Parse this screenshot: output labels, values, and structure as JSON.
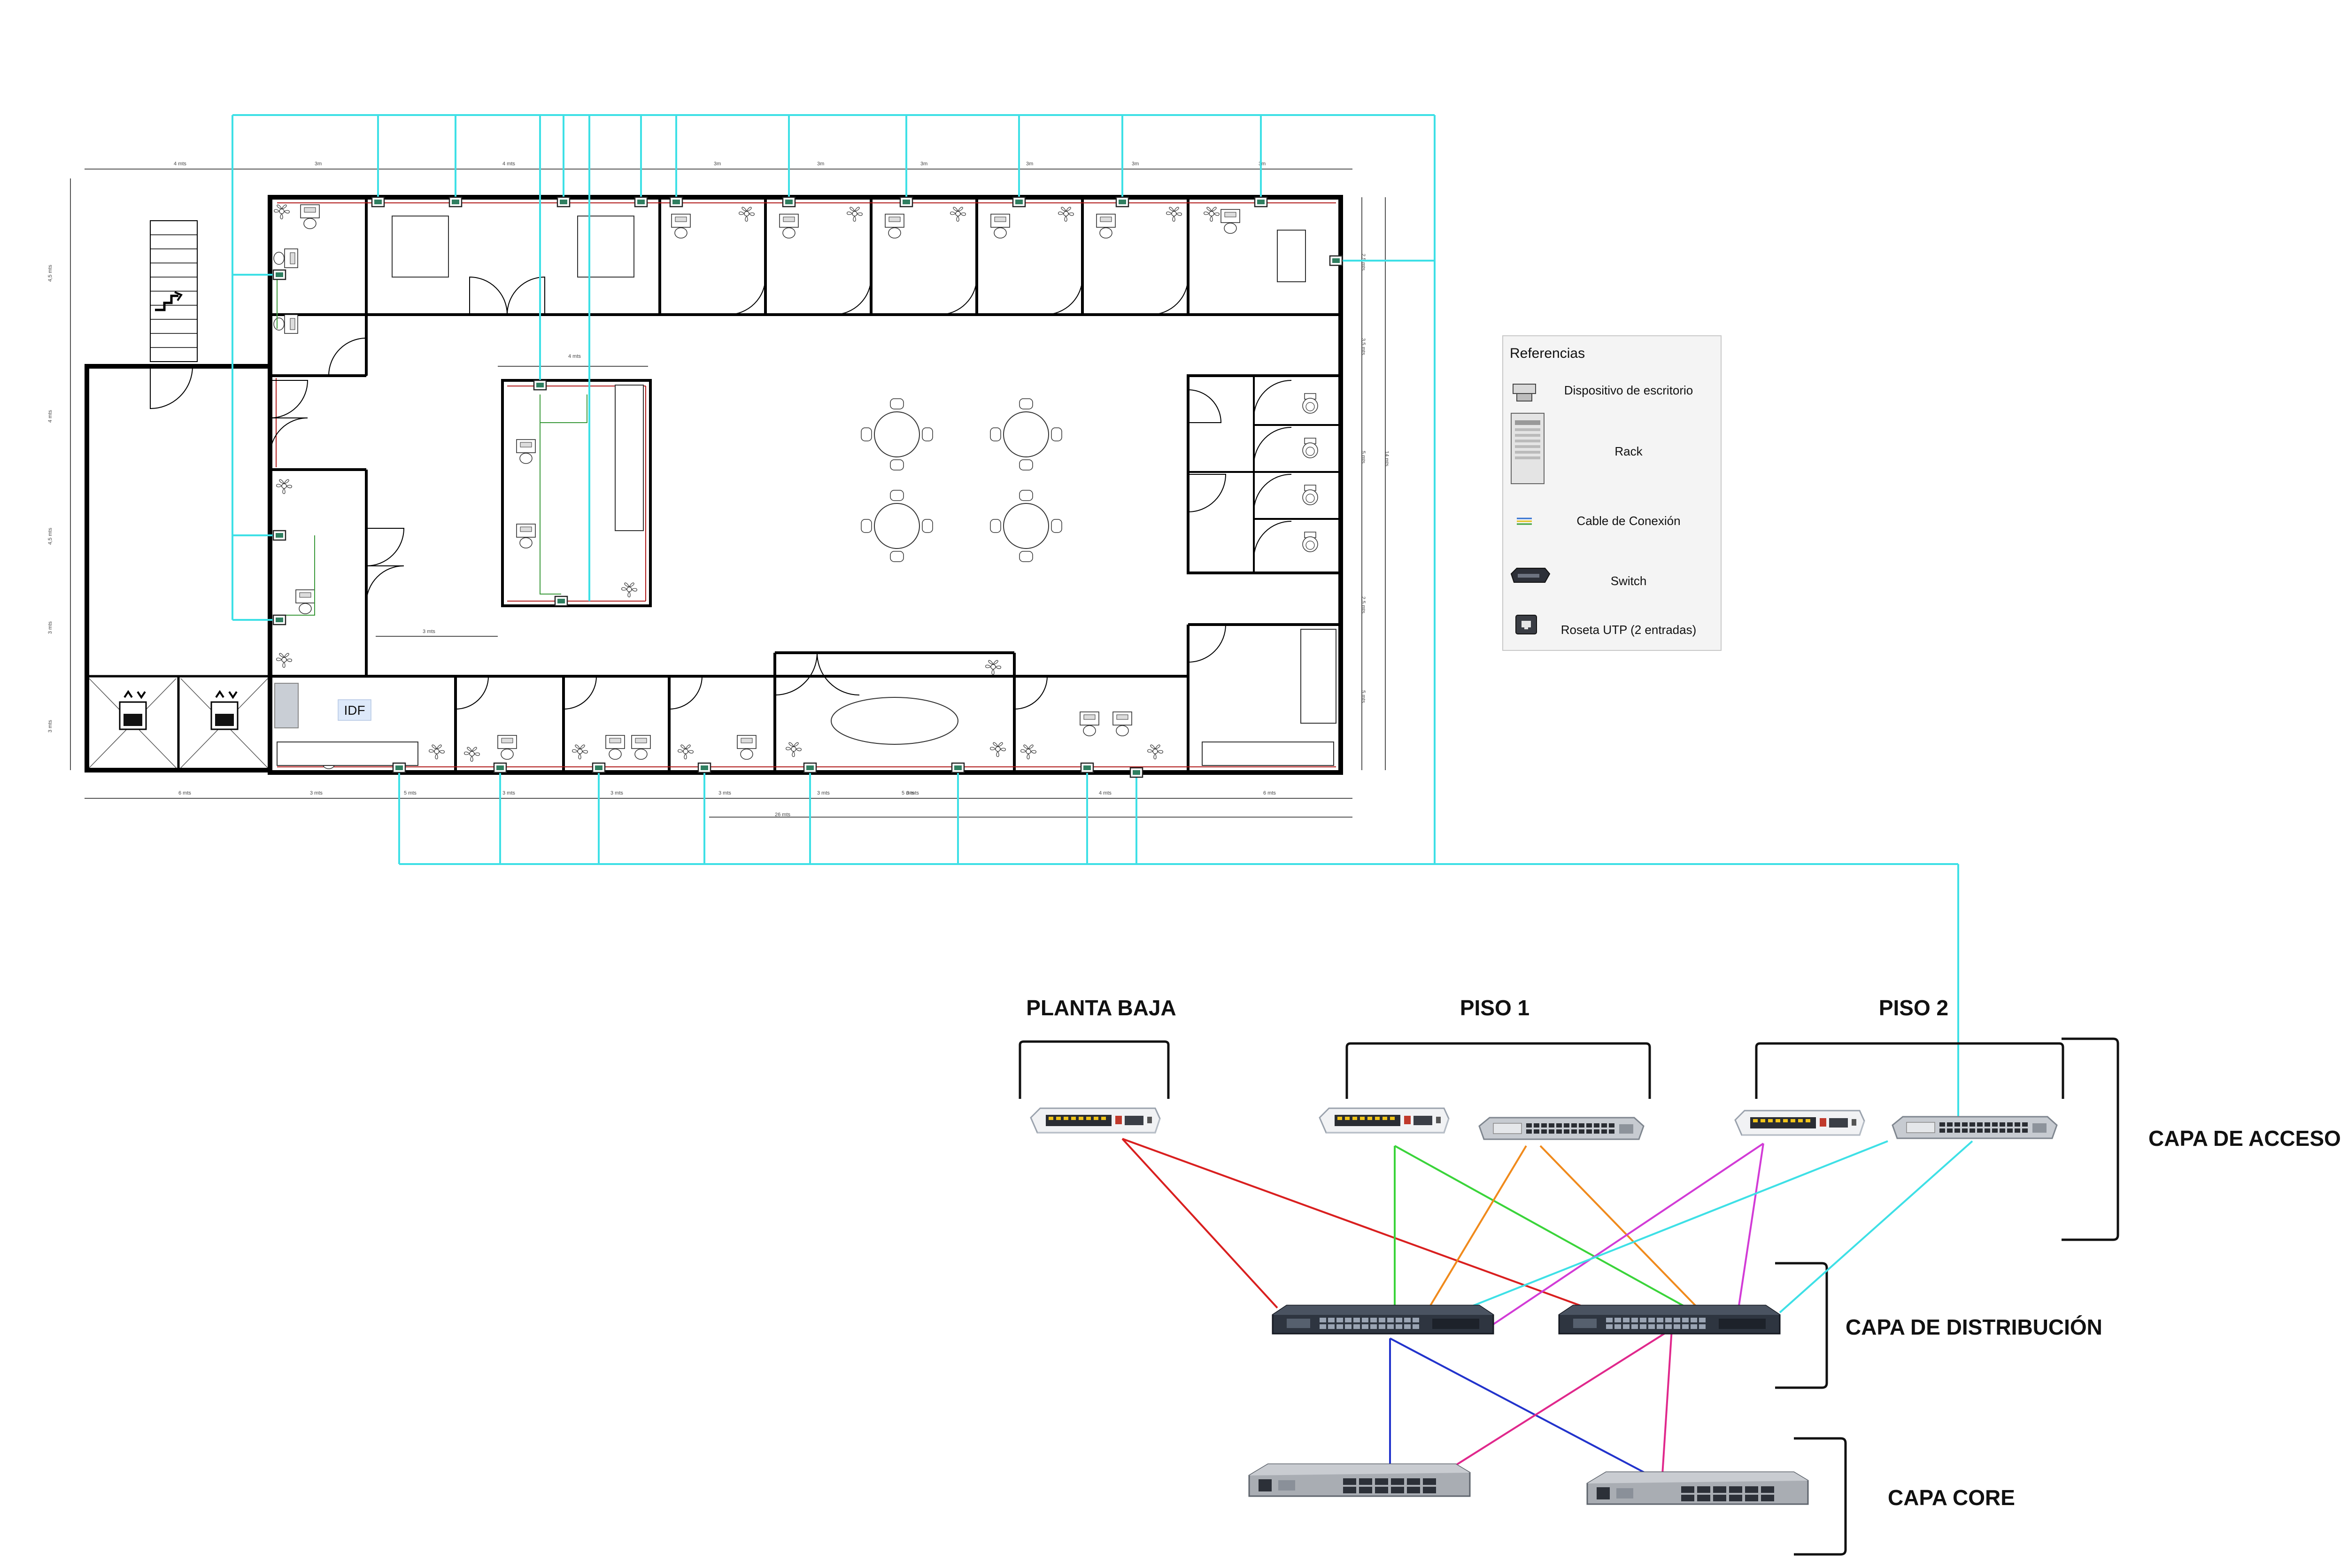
{
  "floor_plan": {
    "room_label": "IDF",
    "dimension_labels": [
      "4 mts",
      "3m",
      "4 mts",
      "3m",
      "3m",
      "3m",
      "3m",
      "3m",
      "3m",
      "4 mts",
      "4,5 mts",
      "4 mts",
      "4,5 mts",
      "3 mts",
      "3 mts",
      "3 mts",
      "3 mts",
      "5 mts",
      "3 mts",
      "6 mts",
      "3 mts",
      "3 mts",
      "3 mts",
      "3 mts",
      "5 mts",
      "4 mts",
      "6 mts",
      "26 mts",
      "2,5 mts",
      "3,5 mts",
      "5 mts",
      "2,5 mts",
      "5 mts",
      "14 mts"
    ]
  },
  "legend": {
    "title": "Referencias",
    "items": [
      {
        "label": "Dispositivo de escritorio",
        "icon": "desktop-device-icon"
      },
      {
        "label": "Rack",
        "icon": "rack-icon"
      },
      {
        "label": "Cable de Conexión",
        "icon": "patch-cable-icon"
      },
      {
        "label": "Switch",
        "icon": "switch-icon"
      },
      {
        "label": "Roseta UTP (2 entradas)",
        "icon": "utp-outlet-icon"
      }
    ]
  },
  "topology": {
    "floors": {
      "ground": "PLANTA BAJA",
      "floor1": "PISO 1",
      "floor2": "PISO 2"
    },
    "layers": {
      "access": "CAPA DE ACCESO",
      "distribution": "CAPA DE DISTRIBUCIÓN",
      "core": "CAPA CORE"
    },
    "link_colors": {
      "ground": "#d91f1f",
      "floor1_a": "#3ad43a",
      "floor1_b": "#f08a1c",
      "floor2_a": "#d23bd6",
      "floor2_b": "#3ee0e6",
      "dist1_core": "#2233cc",
      "dist2_core": "#e0288c",
      "building_uplink": "#3ee0e6",
      "wall": "#000000",
      "wall_red": "#b01818"
    }
  }
}
